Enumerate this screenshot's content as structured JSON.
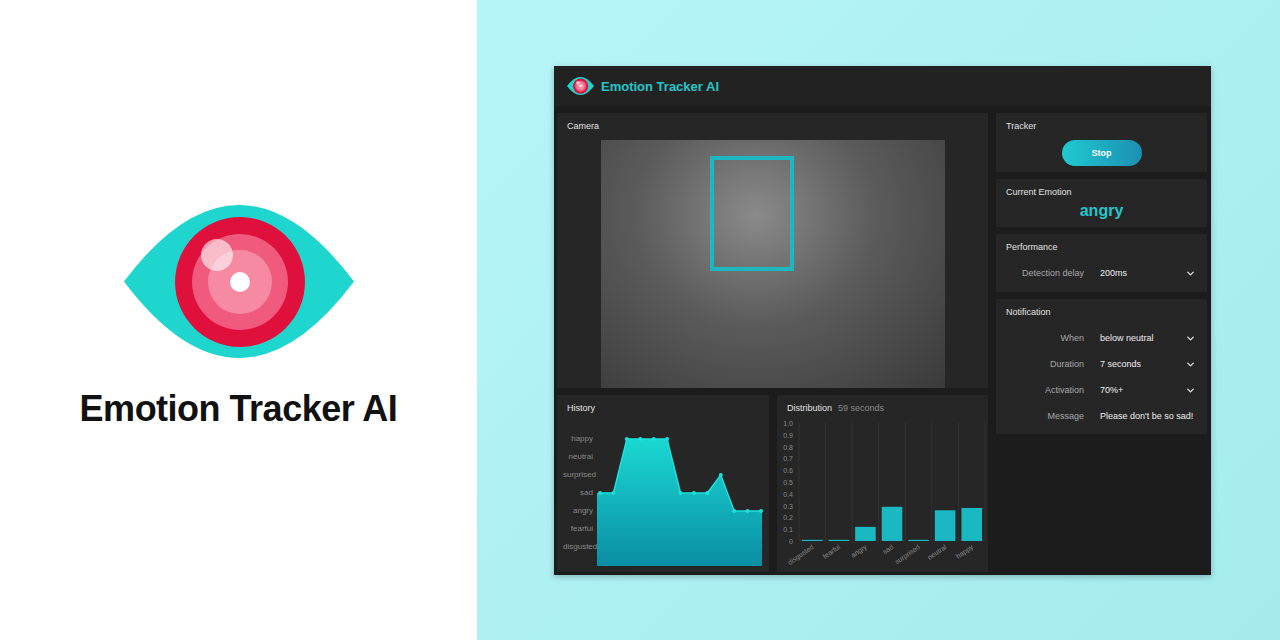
{
  "brand": {
    "title": "Emotion Tracker AI"
  },
  "app": {
    "title": "Emotion Tracker AI"
  },
  "camera": {
    "label": "Camera"
  },
  "tracker": {
    "label": "Tracker",
    "button": "Stop"
  },
  "current_emotion": {
    "label": "Current Emotion",
    "value": "angry"
  },
  "performance": {
    "label": "Performance",
    "fields": [
      {
        "label": "Detection delay",
        "value": "200ms",
        "kind": "select"
      }
    ]
  },
  "notification": {
    "label": "Notification",
    "fields": [
      {
        "label": "When",
        "value": "below neutral",
        "kind": "select"
      },
      {
        "label": "Duration",
        "value": "7 seconds",
        "kind": "select"
      },
      {
        "label": "Activation",
        "value": "70%+",
        "kind": "select"
      },
      {
        "label": "Message",
        "value": "Please don't be so sad!",
        "kind": "text"
      }
    ]
  },
  "history": {
    "label": "History",
    "categories": [
      "happy",
      "neutral",
      "surprised",
      "sad",
      "angry",
      "fearful",
      "disgusted"
    ],
    "values": [
      3,
      3,
      6,
      6,
      6,
      6,
      3,
      3,
      3,
      4,
      2,
      2,
      2
    ]
  },
  "distribution": {
    "label": "Distribution",
    "period": "59 seconds",
    "ticks": [
      "1.0",
      "0.9",
      "0.8",
      "0.7",
      "0.6",
      "0.5",
      "0.4",
      "0.3",
      "0.2",
      "0.1",
      "0"
    ],
    "categories": [
      "disgusted",
      "fearful",
      "angry",
      "sad",
      "surprised",
      "neutral",
      "happy"
    ],
    "values": [
      0.01,
      0.01,
      0.12,
      0.29,
      0.01,
      0.26,
      0.28
    ]
  }
}
